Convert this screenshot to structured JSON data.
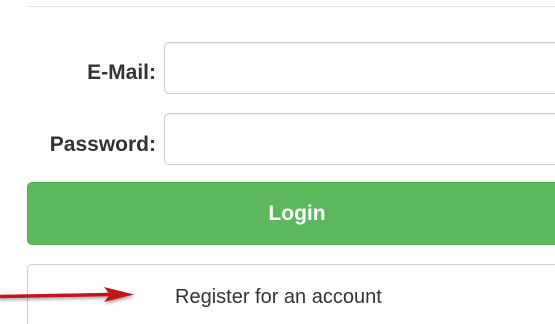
{
  "form": {
    "email_label": "E-Mail:",
    "email_value": "",
    "password_label": "Password:",
    "password_value": "",
    "login_label": "Login",
    "register_label": "Register for an account"
  },
  "colors": {
    "login_button": "#5cb85c",
    "arrow": "#c0141b"
  },
  "icons": {
    "annotation": "red-arrow-icon"
  }
}
